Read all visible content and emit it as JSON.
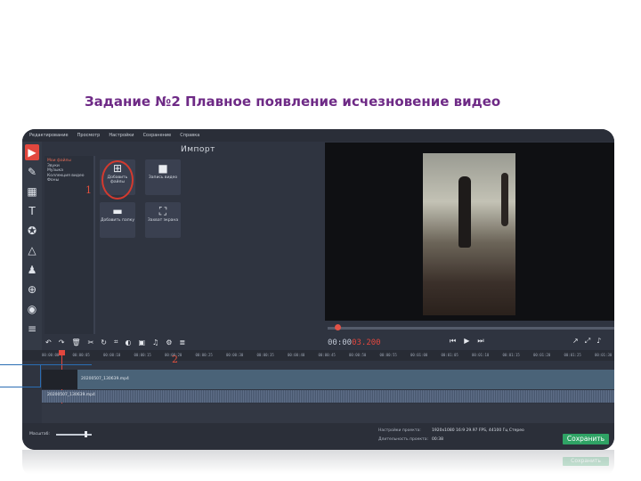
{
  "slide": {
    "title": "Задание №2 Плавное появление исчезновение видео"
  },
  "menu": [
    "Редактирование",
    "Просмотр",
    "Настройки",
    "Сохранение",
    "Справка"
  ],
  "left_tools": [
    "import-icon",
    "brush-icon",
    "film-icon",
    "text-icon",
    "star-icon",
    "shapes-icon",
    "run-icon",
    "zoom-icon",
    "audio-icon",
    "list-icon"
  ],
  "tree": {
    "items": [
      "Мои файлы",
      "Звуки",
      "Музыка",
      "Коллекция видео",
      "Фоны"
    ]
  },
  "import": {
    "title": "Импорт",
    "add_files": "Добавить файлы",
    "record_video": "Запись видео",
    "add_folder": "Добавить папку",
    "screen_capture": "Захват экрана"
  },
  "annotations": {
    "one": "1",
    "two": "2"
  },
  "player": {
    "time_main": "00:00",
    "time_ms": "03.200"
  },
  "ruler": [
    "00:00:00",
    "00:00:05",
    "00:00:10",
    "00:00:15",
    "00:00:20",
    "00:00:25",
    "00:00:30",
    "00:00:35",
    "00:00:40",
    "00:00:45",
    "00:00:50",
    "00:00:55",
    "00:01:00",
    "00:01:05",
    "00:01:10",
    "00:01:15",
    "00:01:20",
    "00:01:25",
    "00:01:30"
  ],
  "timeline": {
    "video_clip": "20200507_130639.mp4",
    "audio_clip": "20200507_130639.mp4"
  },
  "bottom": {
    "scale_label": "Масштаб:",
    "project_settings_label": "Настройки проекта:",
    "project_settings_value": "1920x1080 16:9 29.97 FPS, 44100 Гц Стерео",
    "project_duration_label": "Длительность проекта:",
    "project_duration_value": "00:38",
    "save_button": "Сохранить"
  }
}
